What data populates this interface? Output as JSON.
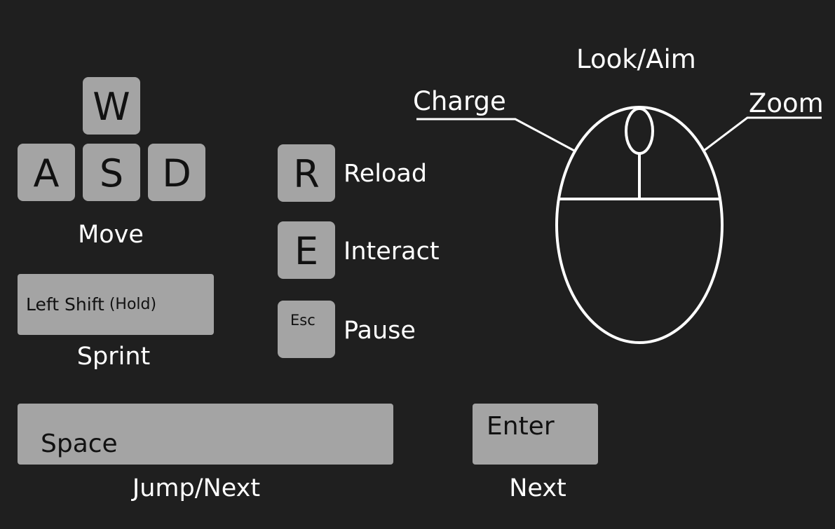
{
  "keys": {
    "w": "W",
    "a": "A",
    "s": "S",
    "d": "D",
    "r": "R",
    "e": "E",
    "esc": "Esc",
    "left_shift": "Left Shift",
    "left_shift_hold": "(Hold)",
    "space": "Space",
    "enter": "Enter"
  },
  "actions": {
    "move": "Move",
    "sprint": "Sprint",
    "reload": "Reload",
    "interact": "Interact",
    "pause": "Pause",
    "jump_next": "Jump/Next",
    "next": "Next"
  },
  "mouse": {
    "look_aim": "Look/Aim",
    "charge": "Charge",
    "zoom": "Zoom"
  },
  "colors": {
    "background": "#1f1f1f",
    "key_fill": "#a4a4a4",
    "key_text": "#111111",
    "label_text": "#ffffff"
  }
}
